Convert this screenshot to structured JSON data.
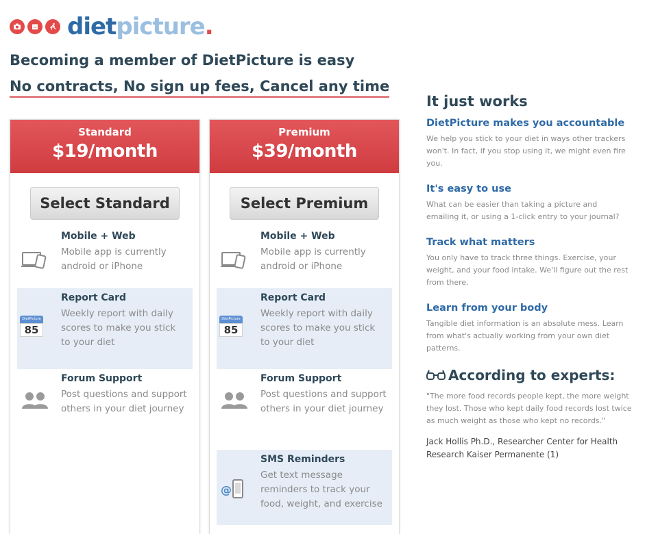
{
  "logo": {
    "icons": [
      "camera-icon",
      "calendar-icon",
      "runner-icon"
    ],
    "text_diet": "diet",
    "text_picture": "picture",
    "text_dot": "."
  },
  "headline": "Becoming a member of DietPicture is easy",
  "subline": "No contracts, No sign up fees, Cancel any time",
  "colors": {
    "accent_red": "#e34a4a",
    "brand_blue": "#2e6aa6",
    "highlight_row": "#e6edf7"
  },
  "plans": [
    {
      "name": "Standard",
      "price": "$19/month",
      "button": "Select Standard",
      "features": [
        {
          "title": "Mobile + Web",
          "desc": "Mobile app is currently android or iPhone",
          "icon": "devices-icon"
        },
        {
          "title": "Report Card",
          "desc": "Weekly report with daily scores to make you stick to your diet",
          "icon": "report-card-icon",
          "score": "85",
          "badge": "DietPicture Score"
        },
        {
          "title": "Forum Support",
          "desc": "Post questions and support others in your diet journey",
          "icon": "people-icon"
        }
      ]
    },
    {
      "name": "Premium",
      "price": "$39/month",
      "button": "Select Premium",
      "features": [
        {
          "title": "Mobile + Web",
          "desc": "Mobile app is currently android or iPhone",
          "icon": "devices-icon"
        },
        {
          "title": "Report Card",
          "desc": "Weekly report with daily scores to make you stick to your diet",
          "icon": "report-card-icon",
          "score": "85",
          "badge": "DietPicture Score"
        },
        {
          "title": "Forum Support",
          "desc": "Post questions and support others in your diet journey",
          "icon": "people-icon"
        },
        {
          "title": "SMS Reminders",
          "desc": "Get text message reminders to track your food, weight, and exercise",
          "icon": "sms-icon"
        }
      ]
    }
  ],
  "right": {
    "title": "It just works",
    "sections": [
      {
        "heading": "DietPicture makes you accountable",
        "body": "We help you stick to your diet in ways other trackers won't. In fact, if you stop using it, we might even fire you."
      },
      {
        "heading": "It's easy to use",
        "body": "What can be easier than taking a picture and emailing it, or using a 1-click entry to your journal?"
      },
      {
        "heading": "Track what matters",
        "body": "You only have to track three things. Exercise, your weight, and your food intake. We'll figure out the rest from there."
      },
      {
        "heading": "Learn from your body",
        "body": "Tangible diet information is an absolute mess. Learn from what's actually working from your own diet patterns."
      }
    ],
    "experts_title": "According to experts:",
    "quote": "\"The more food records people kept, the more weight they lost. Those who kept daily food records lost twice as much weight as those who kept no records.\"",
    "attribution": "Jack Hollis Ph.D., Researcher Center for Health Research Kaiser Permanente (1)"
  }
}
